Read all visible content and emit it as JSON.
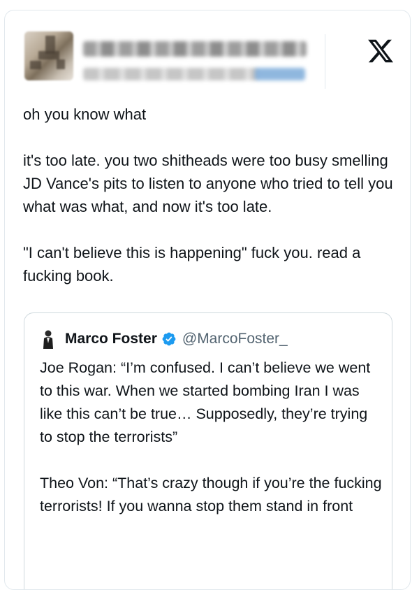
{
  "author": {
    "avatar_icon": "blurred-avatar",
    "name_redacted": true,
    "handle_redacted": true
  },
  "brand": {
    "logo_icon": "x-logo-icon"
  },
  "tweet": {
    "paragraphs": [
      "oh you know what",
      "it's too late. you two shitheads were too busy smelling JD Vance's pits to listen to anyone who tried to tell you what was what, and now it's too late.",
      "\"I can't believe this is happening\" fuck you. read a fucking book."
    ]
  },
  "quoted_tweet": {
    "author_name": "Marco Foster",
    "author_handle": "@MarcoFoster_",
    "verified_icon": "verified-badge-icon",
    "verified_color": "#1d9bf0",
    "paragraphs": [
      "Joe Rogan: “I’m confused. I can’t believe we went to this war. When we started bombing Iran I was like this can’t be true… Supposedly, they’re trying to stop the terrorists”",
      "Theo Von: “That’s crazy though if you’re the fucking terrorists! If you wanna stop them stand in front"
    ]
  }
}
